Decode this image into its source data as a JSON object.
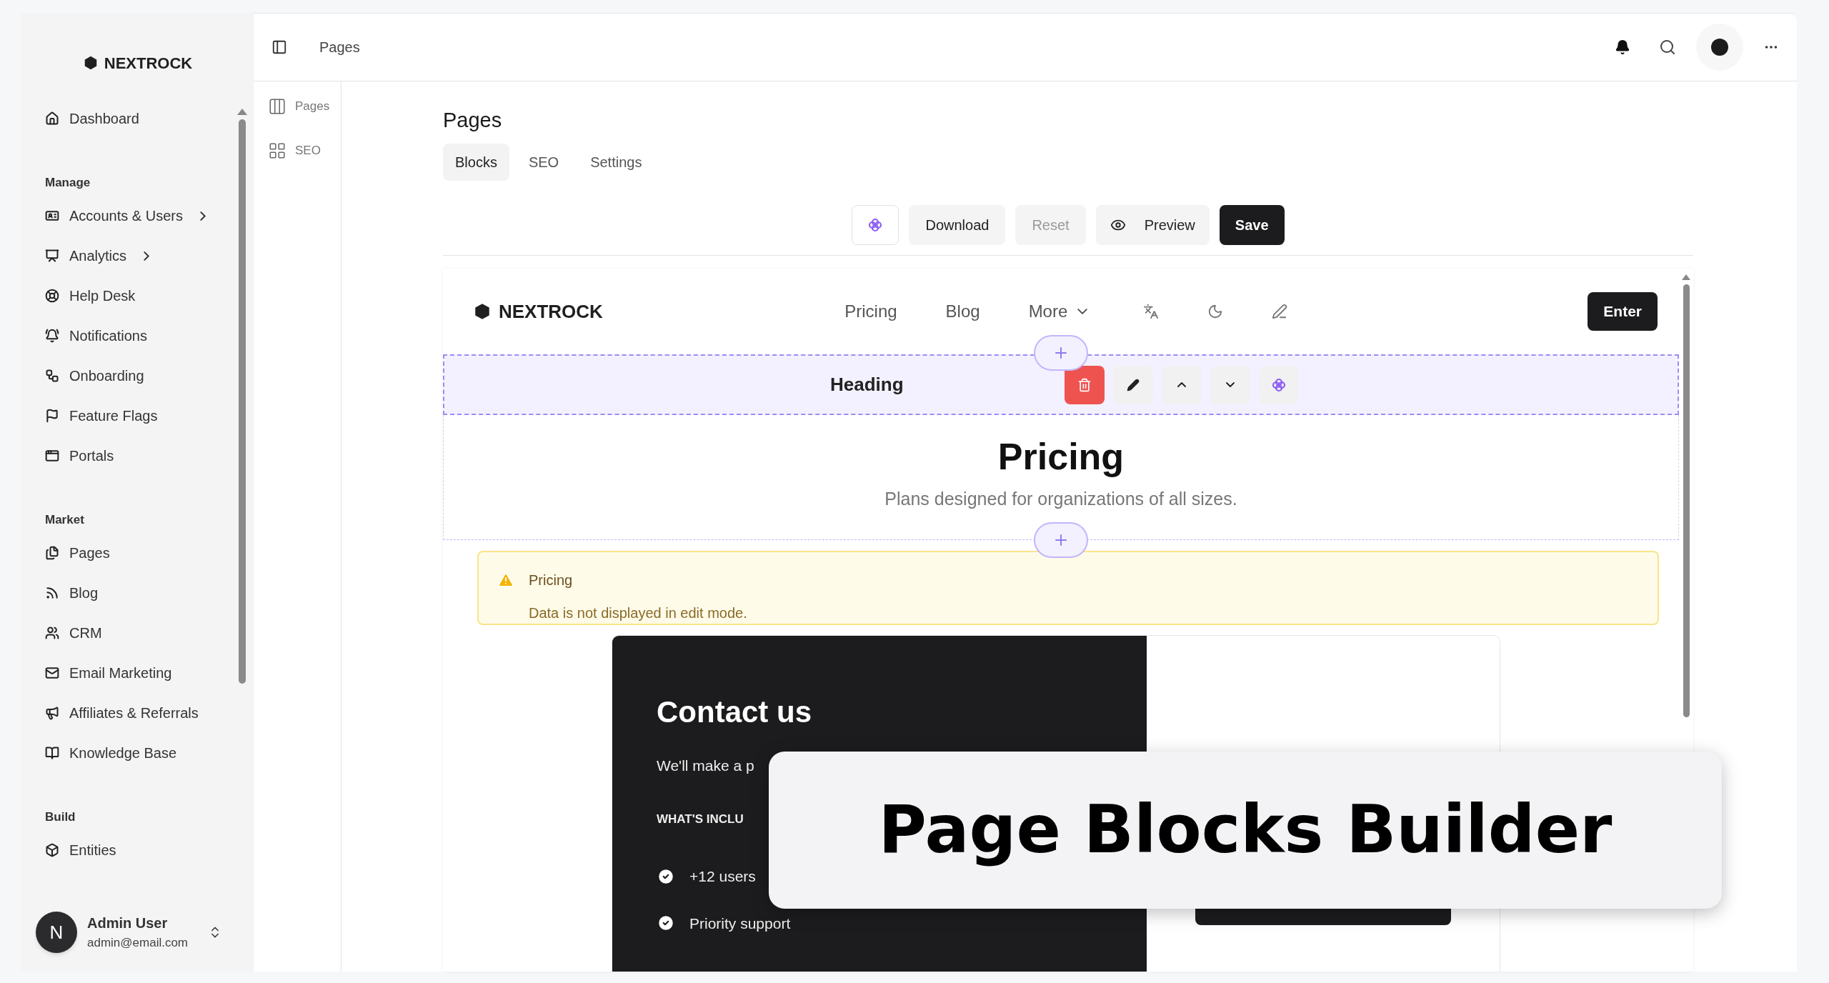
{
  "sidebar": {
    "brand": "NEXTROCK",
    "sections": [
      {
        "items": [
          {
            "label": "Dashboard",
            "expandable": false
          }
        ]
      },
      {
        "title": "Manage",
        "items": [
          {
            "label": "Accounts & Users",
            "expandable": true
          },
          {
            "label": "Analytics",
            "expandable": true
          },
          {
            "label": "Help Desk",
            "expandable": false
          },
          {
            "label": "Notifications",
            "expandable": false
          },
          {
            "label": "Onboarding",
            "expandable": false
          },
          {
            "label": "Feature Flags",
            "expandable": false
          },
          {
            "label": "Portals",
            "expandable": false
          }
        ]
      },
      {
        "title": "Market",
        "items": [
          {
            "label": "Pages",
            "expandable": false
          },
          {
            "label": "Blog",
            "expandable": false
          },
          {
            "label": "CRM",
            "expandable": false
          },
          {
            "label": "Email Marketing",
            "expandable": false
          },
          {
            "label": "Affiliates & Referrals",
            "expandable": false
          },
          {
            "label": "Knowledge Base",
            "expandable": false
          }
        ]
      },
      {
        "title": "Build",
        "items": [
          {
            "label": "Entities",
            "expandable": false
          }
        ]
      }
    ],
    "user": {
      "initial": "N",
      "name": "Admin User",
      "email": "admin@email.com"
    }
  },
  "topbar": {
    "breadcrumb": "Pages"
  },
  "subnav": [
    {
      "label": "Pages"
    },
    {
      "label": "SEO"
    }
  ],
  "page": {
    "title": "Pages",
    "tabs": [
      {
        "label": "Blocks",
        "selected": true
      },
      {
        "label": "SEO",
        "selected": false
      },
      {
        "label": "Settings",
        "selected": false
      }
    ],
    "toolbar": [
      {
        "kind": "ai"
      },
      {
        "kind": "secondary",
        "label": "Download",
        "disabled": false
      },
      {
        "kind": "secondary",
        "label": "Reset",
        "disabled": true
      },
      {
        "kind": "preview",
        "label": "Preview",
        "disabled": false
      },
      {
        "kind": "primary",
        "label": "Save",
        "disabled": false
      }
    ]
  },
  "preview": {
    "brand": "NEXTROCK",
    "links": [
      {
        "label": "Pricing",
        "dropdown": false
      },
      {
        "label": "Blog",
        "dropdown": false
      },
      {
        "label": "More",
        "dropdown": true
      }
    ],
    "enter": "Enter",
    "selected_block": {
      "label": "Heading"
    },
    "hero": {
      "title": "Pricing",
      "subtitle": "Plans designed for organizations of all sizes."
    },
    "alert": {
      "title": "Pricing",
      "message": "Data is not displayed in edit mode."
    },
    "contact": {
      "title": "Contact us",
      "intro": "We'll make a p",
      "section": "WHAT'S INCLU",
      "features": [
        {
          "label": "+12 users"
        },
        {
          "label": "Priority support"
        }
      ]
    }
  },
  "overlay": {
    "caption": "Page Blocks Builder"
  }
}
